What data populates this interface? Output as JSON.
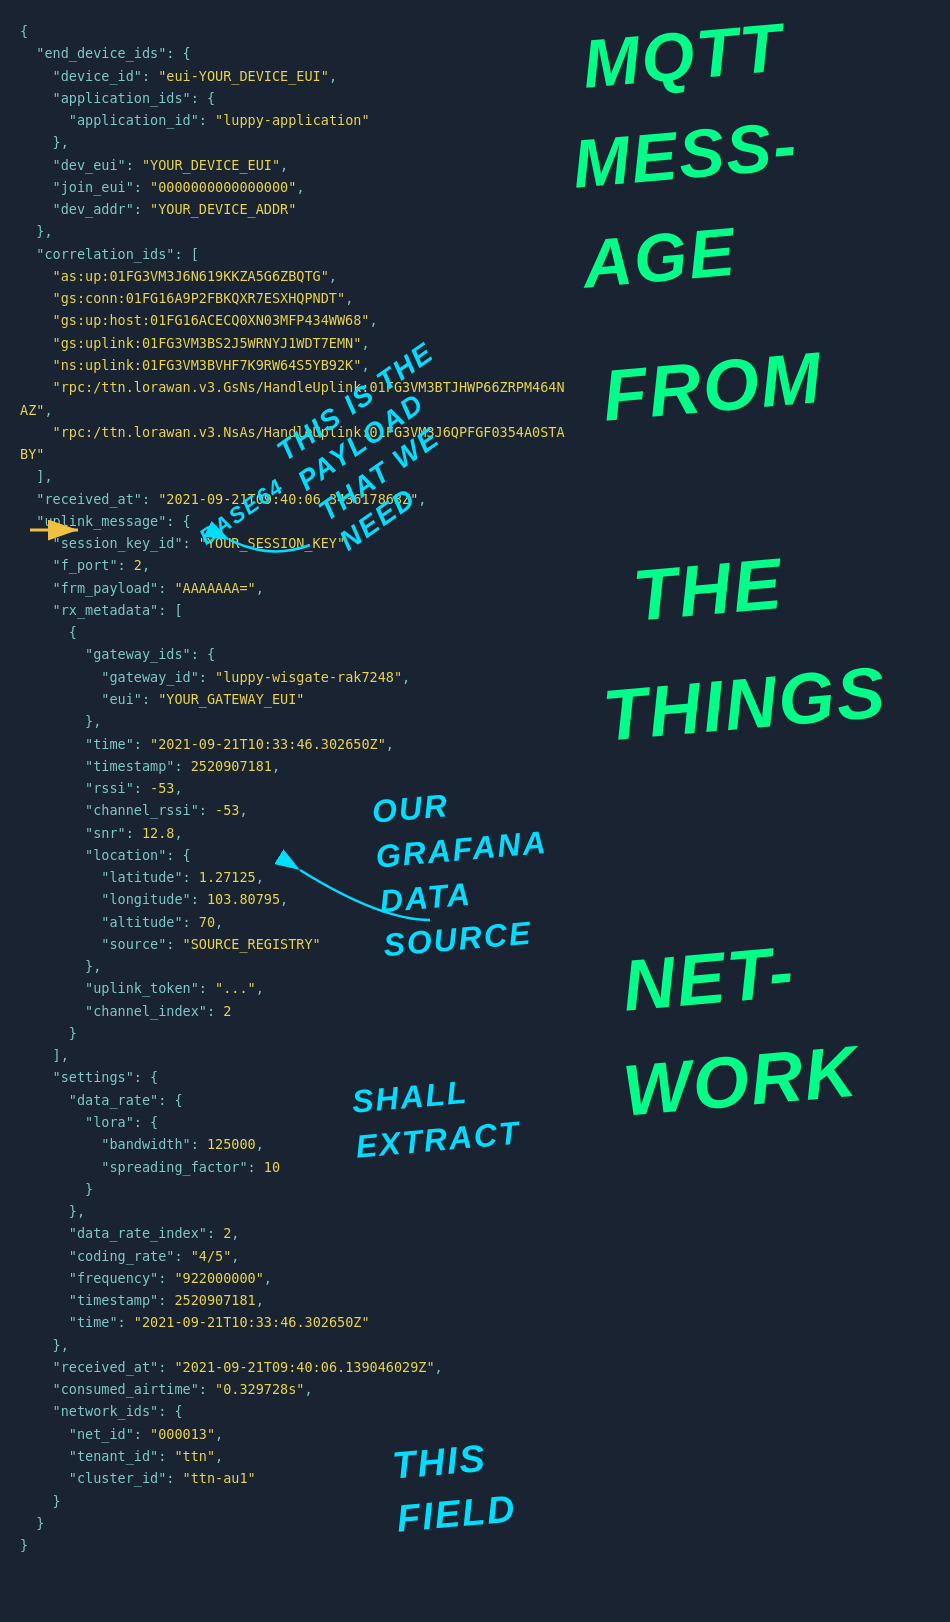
{
  "background": "#1a2332",
  "code": {
    "lines": [
      "{",
      "  \"end_device_ids\": {",
      "    \"device_id\": \"eui-YOUR_DEVICE_EUI\",",
      "    \"application_ids\": {",
      "      \"application_id\": \"luppy-application\"",
      "    },",
      "    \"dev_eui\": \"YOUR_DEVICE_EUI\",",
      "    \"join_eui\": \"0000000000000000\",",
      "    \"dev_addr\": \"YOUR_DEVICE_ADDR\"",
      "  },",
      "  \"correlation_ids\": [",
      "    \"as:up:01FG3VM3J6N619KKZA5G6ZBQTG\",",
      "    \"gs:conn:01FG16A9P2FBKQXR7ESXHQPNDT\",",
      "    \"gs:up:host:01FG16ACECQ0XN03MFP434WW68\",",
      "    \"gs:uplink:01FG3VM3BS2J5WRNYJ1WDT7EMN\",",
      "    \"ns:uplink:01FG3VM3BVHF7K9RW64S5YB92K\",",
      "    \"rpc:/ttn.lorawan.v3.GsNs/HandleUplink:01FG3VM3BTJHWP66ZRPM464NAZ\",",
      "    \"rpc:/ttn.lorawan.v3.NsAs/HandleUplink:01FG3VM3J6QPFGF0354A0STABY\"",
      "  ],",
      "  \"received_at\": \"2021-09-21T09:40:06.343617863Z\",",
      "  \"uplink_message\": {",
      "    \"session_key_id\": \"YOUR_SESSION_KEY\",",
      "    \"f_port\": 2,",
      "    \"frm_payload\": \"AAAAAAA=\",",
      "    \"rx_metadata\": [",
      "      {",
      "        \"gateway_ids\": {",
      "          \"gateway_id\": \"luppy-wisgate-rak7248\",",
      "          \"eui\": \"YOUR_GATEWAY_EUI\"",
      "        },",
      "        \"time\": \"2021-09-21T10:33:46.302650Z\",",
      "        \"timestamp\": 2520907181,",
      "        \"rssi\": -53,",
      "        \"channel_rssi\": -53,",
      "        \"snr\": 12.8,",
      "        \"location\": {",
      "          \"latitude\": 1.27125,",
      "          \"longitude\": 103.80795,",
      "          \"altitude\": 70,",
      "          \"source\": \"SOURCE_REGISTRY\"",
      "        },",
      "        \"uplink_token\": \"...\",",
      "        \"channel_index\": 2",
      "      }",
      "    ],",
      "    \"settings\": {",
      "      \"data_rate\": {",
      "        \"lora\": {",
      "          \"bandwidth\": 125000,",
      "          \"spreading_factor\": 10",
      "        }",
      "      },",
      "      \"data_rate_index\": 2,",
      "      \"coding_rate\": \"4/5\",",
      "      \"frequency\": \"922000000\",",
      "      \"timestamp\": 2520907181,",
      "      \"time\": \"2021-09-21T10:33:46.302650Z\"",
      "    },",
      "    \"received_at\": \"2021-09-21T09:40:06.139046029Z\",",
      "    \"consumed_airtime\": \"0.329728s\",",
      "    \"network_ids\": {",
      "      \"net_id\": \"000013\",",
      "      \"tenant_id\": \"ttn\",",
      "      \"cluster_id\": \"ttn-au1\"",
      "    }",
      "  }",
      "}"
    ]
  },
  "annotations": {
    "mqtt_message": "MQTT\nMESS-\nAGE",
    "from": "FROM",
    "the": "THE",
    "things": "THINGS",
    "network": "NET-\nWORK",
    "this_is_the_payload": "THIS IS THE\nPAYLOAD\nTHAT WE\nNEED",
    "base64": "BASE64",
    "our_grafana": "OUR\nGRAFANA\nDATA\nSOURCE",
    "shall_extract": "SHALL\nEXTRACT",
    "this_field": "THIS\nFIELD"
  }
}
